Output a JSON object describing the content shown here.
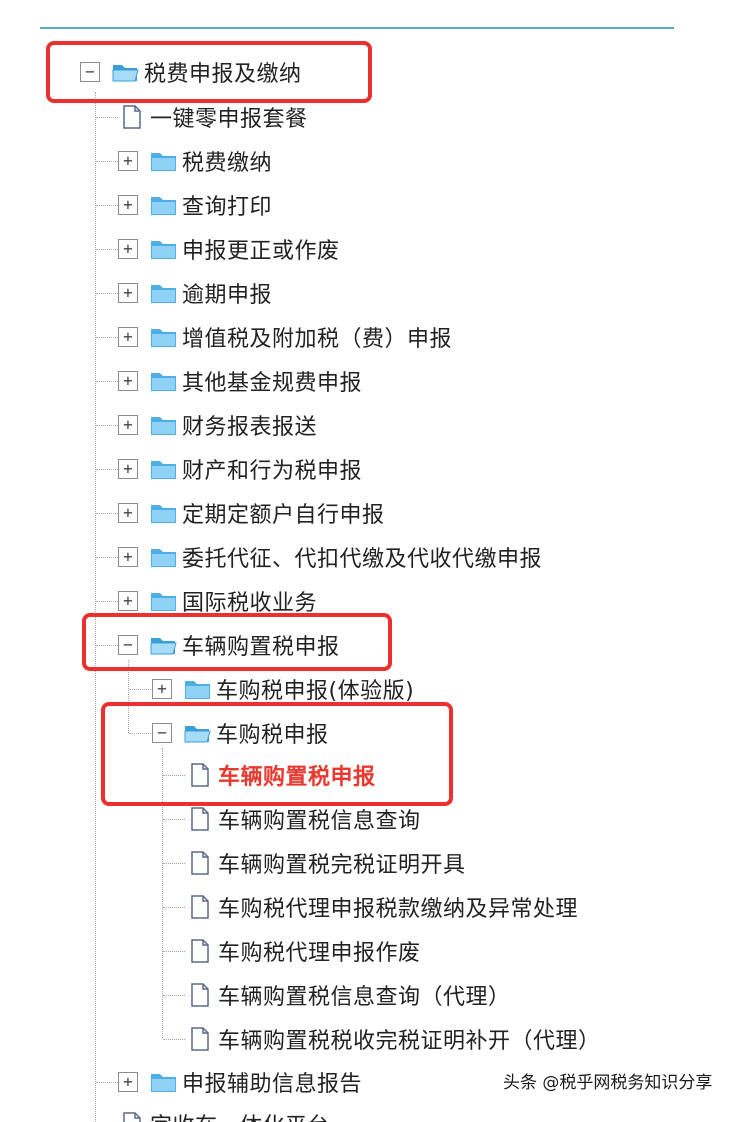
{
  "tree": {
    "root": {
      "label": "税费申报及缴纳",
      "toggle": "−"
    },
    "items": [
      {
        "label": "一键零申报套餐",
        "icon": "document-icon"
      },
      {
        "label": "税费缴纳",
        "toggle": "+",
        "icon": "folder-icon"
      },
      {
        "label": "查询打印",
        "toggle": "+",
        "icon": "folder-icon"
      },
      {
        "label": "申报更正或作废",
        "toggle": "+",
        "icon": "folder-icon"
      },
      {
        "label": "逾期申报",
        "toggle": "+",
        "icon": "folder-icon"
      },
      {
        "label": "增值税及附加税（费）申报",
        "toggle": "+",
        "icon": "folder-icon"
      },
      {
        "label": "其他基金规费申报",
        "toggle": "+",
        "icon": "folder-icon"
      },
      {
        "label": "财务报表报送",
        "toggle": "+",
        "icon": "folder-icon"
      },
      {
        "label": "财产和行为税申报",
        "toggle": "+",
        "icon": "folder-icon"
      },
      {
        "label": "定期定额户自行申报",
        "toggle": "+",
        "icon": "folder-icon"
      },
      {
        "label": "委托代征、代扣代缴及代收代缴申报",
        "toggle": "+",
        "icon": "folder-icon"
      },
      {
        "label": "国际税收业务",
        "toggle": "+",
        "icon": "folder-icon"
      }
    ],
    "vehicle": {
      "label": "车辆购置税申报",
      "toggle": "−",
      "children": [
        {
          "label": "车购税申报(体验版)",
          "toggle": "+"
        },
        {
          "label": "车购税申报",
          "toggle": "−"
        }
      ],
      "leaves": [
        {
          "label": "车辆购置税申报",
          "active": true
        },
        {
          "label": "车辆购置税信息查询"
        },
        {
          "label": "车辆购置税完税证明开具"
        },
        {
          "label": "车购税代理申报税款缴纳及异常处理"
        },
        {
          "label": "车购税代理申报作废"
        },
        {
          "label": "车辆购置税信息查询（代理）"
        },
        {
          "label": "车辆购置税税收完税证明补开（代理）"
        }
      ]
    },
    "after": [
      {
        "label": "申报辅助信息报告",
        "toggle": "+"
      },
      {
        "label": "字收在一体化平台"
      }
    ]
  },
  "colors": {
    "accent_rule": "#5aaeb8",
    "highlight": "#ee2f2f",
    "active_text": "#e8392f",
    "folder": "#4cb0e6"
  },
  "watermark": "头条 @税乎网税务知识分享"
}
